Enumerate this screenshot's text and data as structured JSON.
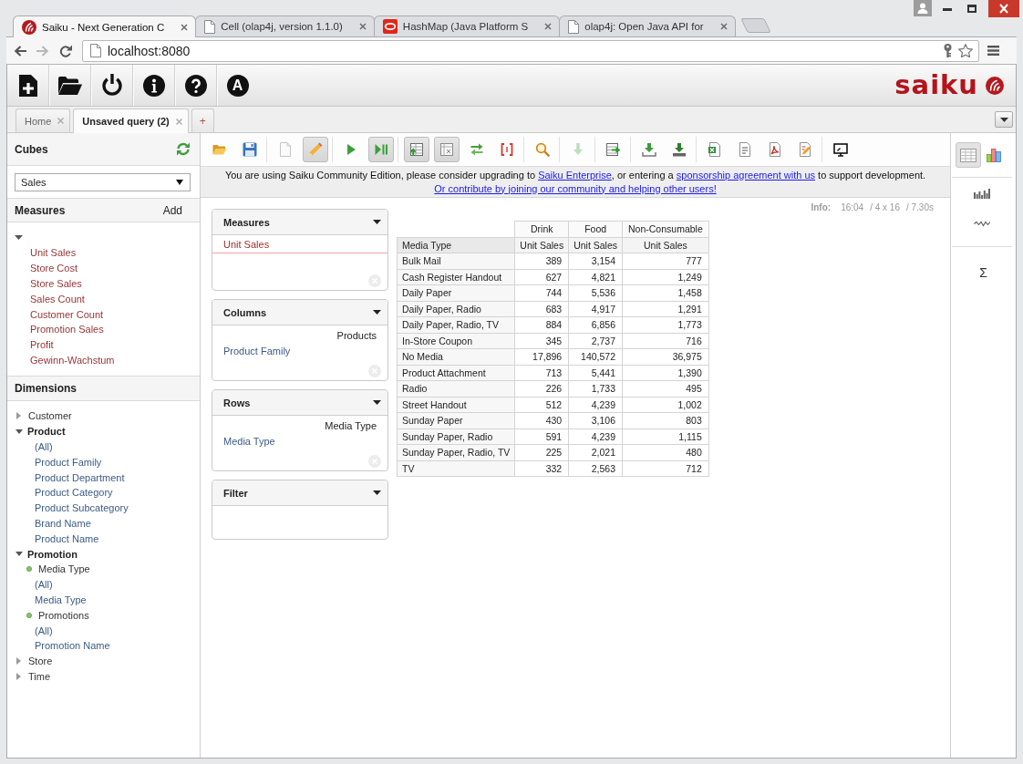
{
  "browser": {
    "tabs": [
      {
        "title": "Saiku - Next Generation C",
        "kind": "logo",
        "selected": true
      },
      {
        "title": "Cell (olap4j, version 1.1.0)",
        "kind": "page",
        "selected": false
      },
      {
        "title": "HashMap (Java Platform S",
        "kind": "ring",
        "selected": false
      },
      {
        "title": "olap4j: Open Java API for",
        "kind": "page",
        "selected": false
      }
    ],
    "can_go_forward": false,
    "address": "localhost:8080"
  },
  "app_header": {
    "letter_button": "A",
    "logo": "saiku"
  },
  "query_tabs": {
    "tabs": [
      {
        "label": "Home",
        "selected": false
      },
      {
        "label": "Unsaved query (2)",
        "selected": true
      }
    ],
    "new_tab": "+"
  },
  "sidebar": {
    "cubes": {
      "title": "Cubes",
      "selected_cube": "Sales"
    },
    "measures": {
      "title": "Measures",
      "add_label": "Add",
      "expanded": true,
      "items": [
        "Unit Sales",
        "Store Cost",
        "Store Sales",
        "Sales Count",
        "Customer Count",
        "Promotion Sales",
        "Profit",
        "Gewinn-Wachstum"
      ]
    },
    "dimensions": {
      "title": "Dimensions",
      "items": [
        {
          "label": "Customer",
          "expanded": false
        },
        {
          "label": "Product",
          "expanded": true,
          "children": [
            {
              "label": "(All)",
              "kind": "level"
            },
            {
              "label": "Product Family",
              "kind": "level"
            },
            {
              "label": "Product Department",
              "kind": "level"
            },
            {
              "label": "Product Category",
              "kind": "level"
            },
            {
              "label": "Product Subcategory",
              "kind": "level"
            },
            {
              "label": "Brand Name",
              "kind": "level"
            },
            {
              "label": "Product Name",
              "kind": "level"
            }
          ]
        },
        {
          "label": "Promotion",
          "expanded": true,
          "children": [
            {
              "label": "Media Type",
              "kind": "hierarchy",
              "children": [
                {
                  "label": "(All)",
                  "kind": "level"
                },
                {
                  "label": "Media Type",
                  "kind": "level"
                }
              ]
            },
            {
              "label": "Promotions",
              "kind": "hierarchy",
              "children": [
                {
                  "label": "(All)",
                  "kind": "level"
                },
                {
                  "label": "Promotion Name",
                  "kind": "level"
                }
              ]
            }
          ]
        },
        {
          "label": "Store",
          "expanded": false
        },
        {
          "label": "Time",
          "expanded": false
        }
      ]
    }
  },
  "query_toolbar": {
    "groups": [
      {
        "buttons": [
          {
            "kind": "open",
            "on": false,
            "disabled": false
          },
          {
            "kind": "save",
            "on": false,
            "disabled": false
          }
        ]
      },
      {
        "buttons": [
          {
            "kind": "new",
            "on": false,
            "disabled": false
          },
          {
            "kind": "edit",
            "on": true,
            "disabled": false
          }
        ]
      },
      {
        "buttons": [
          {
            "kind": "run",
            "on": false,
            "disabled": false
          },
          {
            "kind": "autorun",
            "on": true,
            "disabled": false
          }
        ]
      },
      {
        "buttons": [
          {
            "kind": "fields",
            "on": true,
            "disabled": false
          },
          {
            "kind": "layout",
            "on": true,
            "disabled": false
          },
          {
            "kind": "swap",
            "on": false,
            "disabled": false
          },
          {
            "kind": "nonempty",
            "on": false,
            "disabled": false
          }
        ]
      },
      {
        "buttons": [
          {
            "kind": "zoom",
            "on": false,
            "disabled": false
          }
        ]
      },
      {
        "buttons": [
          {
            "kind": "drill",
            "on": false,
            "disabled": true
          }
        ]
      },
      {
        "buttons": [
          {
            "kind": "drillacross",
            "on": false,
            "disabled": false
          }
        ]
      },
      {
        "buttons": [
          {
            "kind": "export",
            "on": false,
            "disabled": false
          },
          {
            "kind": "exportalt",
            "on": false,
            "disabled": false
          }
        ]
      },
      {
        "buttons": [
          {
            "kind": "spreadsheet",
            "on": false,
            "disabled": false
          },
          {
            "kind": "csv",
            "on": false,
            "disabled": false
          },
          {
            "kind": "pdf",
            "on": false,
            "disabled": false
          },
          {
            "kind": "query",
            "on": false,
            "disabled": false
          }
        ]
      },
      {
        "buttons": [
          {
            "kind": "screen",
            "on": false,
            "disabled": false
          }
        ]
      }
    ]
  },
  "notice": {
    "parts": [
      {
        "kind": "text",
        "text": "You are using Saiku Community Edition, please consider upgrading to "
      },
      {
        "kind": "link",
        "text": "Saiku Enterprise"
      },
      {
        "kind": "text",
        "text": ", or entering a "
      },
      {
        "kind": "link",
        "text": "sponsorship agreement with us"
      },
      {
        "kind": "text",
        "text": " to support development. "
      },
      {
        "kind": "link",
        "text": "Or contribute by joining our community and helping other users!"
      }
    ]
  },
  "info": {
    "label": "Info:",
    "values": [
      "16:04",
      "/ 4 x 16",
      "/ 7.30s"
    ]
  },
  "drop_zones": [
    {
      "title": "Measures",
      "kind": "measures",
      "items": [
        "Unit Sales"
      ]
    },
    {
      "title": "Columns",
      "kind": "levels",
      "hierarchy": "Products",
      "items": [
        "Product Family"
      ]
    },
    {
      "title": "Rows",
      "kind": "levels",
      "hierarchy": "Media Type",
      "items": [
        "Media Type"
      ]
    },
    {
      "title": "Filter",
      "kind": "levels"
    }
  ],
  "table": {
    "column_groups": [
      "Drink",
      "Food",
      "Non-Consumable"
    ],
    "row_header": "Media Type",
    "measure_headers": [
      "Unit Sales",
      "Unit Sales",
      "Unit Sales"
    ],
    "rows": [
      {
        "label": "Bulk Mail",
        "values": [
          "389",
          "3,154",
          "777"
        ]
      },
      {
        "label": "Cash Register Handout",
        "values": [
          "627",
          "4,821",
          "1,249"
        ]
      },
      {
        "label": "Daily Paper",
        "values": [
          "744",
          "5,536",
          "1,458"
        ]
      },
      {
        "label": "Daily Paper, Radio",
        "values": [
          "683",
          "4,917",
          "1,291"
        ]
      },
      {
        "label": "Daily Paper, Radio, TV",
        "values": [
          "884",
          "6,856",
          "1,773"
        ]
      },
      {
        "label": "In-Store Coupon",
        "values": [
          "345",
          "2,737",
          "716"
        ]
      },
      {
        "label": "No Media",
        "values": [
          "17,896",
          "140,572",
          "36,975"
        ]
      },
      {
        "label": "Product Attachment",
        "values": [
          "713",
          "5,441",
          "1,390"
        ]
      },
      {
        "label": "Radio",
        "values": [
          "226",
          "1,733",
          "495"
        ]
      },
      {
        "label": "Street Handout",
        "values": [
          "512",
          "4,239",
          "1,002"
        ]
      },
      {
        "label": "Sunday Paper",
        "values": [
          "430",
          "3,106",
          "803"
        ]
      },
      {
        "label": "Sunday Paper, Radio",
        "values": [
          "591",
          "4,239",
          "1,115"
        ]
      },
      {
        "label": "Sunday Paper, Radio, TV",
        "values": [
          "225",
          "2,021",
          "480"
        ]
      },
      {
        "label": "TV",
        "values": [
          "332",
          "2,563",
          "712"
        ]
      }
    ]
  },
  "view_panel": {
    "modes": [
      {
        "kind": "table",
        "selected": true
      },
      {
        "kind": "chart",
        "selected": false
      }
    ],
    "sum_label": "Σ"
  }
}
